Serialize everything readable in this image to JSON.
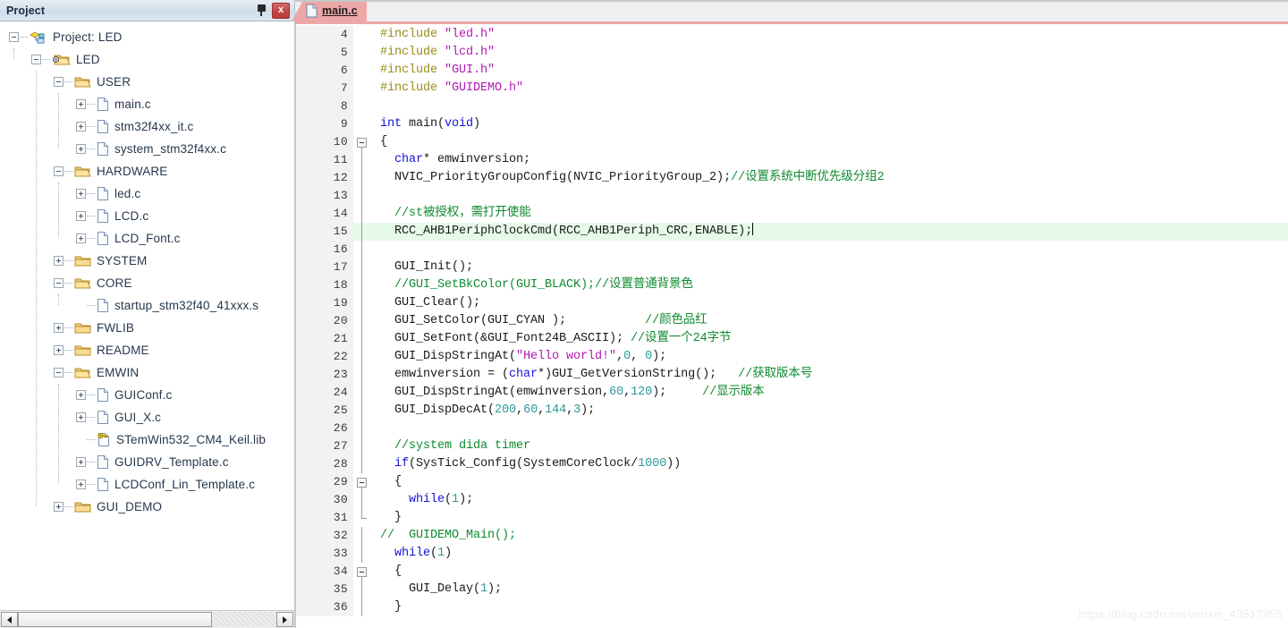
{
  "panel": {
    "title": "Project",
    "pin_icon": "pin-icon",
    "close_icon": "close-icon",
    "close_label": "x"
  },
  "tree": [
    {
      "label": "Project: LED",
      "depth": 0,
      "expander": "minus",
      "icon": "project-icon"
    },
    {
      "label": "LED",
      "depth": 1,
      "expander": "minus",
      "icon": "target-folder-icon"
    },
    {
      "label": "USER",
      "depth": 2,
      "expander": "minus",
      "icon": "folder-open-icon"
    },
    {
      "label": "main.c",
      "depth": 3,
      "expander": "plus",
      "icon": "file-icon"
    },
    {
      "label": "stm32f4xx_it.c",
      "depth": 3,
      "expander": "plus",
      "icon": "file-icon"
    },
    {
      "label": "system_stm32f4xx.c",
      "depth": 3,
      "expander": "plus",
      "icon": "file-icon"
    },
    {
      "label": "HARDWARE",
      "depth": 2,
      "expander": "minus",
      "icon": "folder-open-icon"
    },
    {
      "label": "led.c",
      "depth": 3,
      "expander": "plus",
      "icon": "file-icon"
    },
    {
      "label": "LCD.c",
      "depth": 3,
      "expander": "plus",
      "icon": "file-icon"
    },
    {
      "label": "LCD_Font.c",
      "depth": 3,
      "expander": "plus",
      "icon": "file-icon"
    },
    {
      "label": "SYSTEM",
      "depth": 2,
      "expander": "plus",
      "icon": "folder-closed-icon"
    },
    {
      "label": "CORE",
      "depth": 2,
      "expander": "minus",
      "icon": "folder-open-icon"
    },
    {
      "label": "startup_stm32f40_41xxx.s",
      "depth": 3,
      "expander": "none",
      "icon": "file-icon"
    },
    {
      "label": "FWLIB",
      "depth": 2,
      "expander": "plus",
      "icon": "folder-closed-icon"
    },
    {
      "label": "README",
      "depth": 2,
      "expander": "plus",
      "icon": "folder-closed-icon"
    },
    {
      "label": "EMWIN",
      "depth": 2,
      "expander": "minus",
      "icon": "folder-open-icon"
    },
    {
      "label": "GUIConf.c",
      "depth": 3,
      "expander": "plus",
      "icon": "file-icon"
    },
    {
      "label": "GUI_X.c",
      "depth": 3,
      "expander": "plus",
      "icon": "file-icon"
    },
    {
      "label": "STemWin532_CM4_Keil.lib",
      "depth": 3,
      "expander": "none",
      "icon": "lib-key-icon"
    },
    {
      "label": "GUIDRV_Template.c",
      "depth": 3,
      "expander": "plus",
      "icon": "file-icon"
    },
    {
      "label": "LCDConf_Lin_Template.c",
      "depth": 3,
      "expander": "plus",
      "icon": "file-icon"
    },
    {
      "label": "GUI_DEMO",
      "depth": 2,
      "expander": "plus",
      "icon": "folder-closed-icon"
    }
  ],
  "scrollbar": {
    "left_arrow_icon": "arrow-left-icon",
    "right_arrow_icon": "arrow-right-icon",
    "thumb_percent": 75
  },
  "editor": {
    "tab": {
      "label": "main.c",
      "icon": "document-icon"
    },
    "highlight_line": 15,
    "highlight_color": "#e7f9e9",
    "first_line": 4,
    "colors": {
      "keyword": "#1515d6",
      "preprocessor": "#9a8d1a",
      "string": "#b418b4",
      "comment": "#0f8a2f",
      "number": "#2f9a9a",
      "plain": "#1a1a1a"
    },
    "lines": [
      {
        "n": 4,
        "fold": "none",
        "tokens": [
          {
            "t": "#include ",
            "c": "pp"
          },
          {
            "t": "\"led.h\"",
            "c": "st"
          }
        ]
      },
      {
        "n": 5,
        "fold": "none",
        "tokens": [
          {
            "t": "#include ",
            "c": "pp"
          },
          {
            "t": "\"lcd.h\"",
            "c": "st"
          }
        ]
      },
      {
        "n": 6,
        "fold": "none",
        "tokens": [
          {
            "t": "#include ",
            "c": "pp"
          },
          {
            "t": "\"GUI.h\"",
            "c": "st"
          }
        ]
      },
      {
        "n": 7,
        "fold": "none",
        "tokens": [
          {
            "t": "#include ",
            "c": "pp"
          },
          {
            "t": "\"GUIDEMO.h\"",
            "c": "st"
          }
        ]
      },
      {
        "n": 8,
        "fold": "none",
        "tokens": []
      },
      {
        "n": 9,
        "fold": "none",
        "tokens": [
          {
            "t": "int ",
            "c": "k"
          },
          {
            "t": "main(",
            "c": "pl"
          },
          {
            "t": "void",
            "c": "k"
          },
          {
            "t": ")",
            "c": "pl"
          }
        ]
      },
      {
        "n": 10,
        "fold": "box",
        "tokens": [
          {
            "t": "{",
            "c": "pl"
          }
        ]
      },
      {
        "n": 11,
        "fold": "line",
        "tokens": [
          {
            "t": "  ",
            "c": "pl"
          },
          {
            "t": "char",
            "c": "k"
          },
          {
            "t": "* emwinversion;",
            "c": "pl"
          }
        ]
      },
      {
        "n": 12,
        "fold": "line",
        "tokens": [
          {
            "t": "  NVIC_PriorityGroupConfig(NVIC_PriorityGroup_2);",
            "c": "pl"
          },
          {
            "t": "//设置系统中断优先级分组2",
            "c": "cm"
          }
        ]
      },
      {
        "n": 13,
        "fold": "line",
        "tokens": []
      },
      {
        "n": 14,
        "fold": "line",
        "tokens": [
          {
            "t": "  //st被授权，需打开使能",
            "c": "cm"
          }
        ]
      },
      {
        "n": 15,
        "fold": "line",
        "tokens": [
          {
            "t": "  RCC_AHB1PeriphClockCmd(RCC_AHB1Periph_CRC,ENABLE);",
            "c": "pl"
          }
        ],
        "caret": true
      },
      {
        "n": 16,
        "fold": "line",
        "tokens": []
      },
      {
        "n": 17,
        "fold": "line",
        "tokens": [
          {
            "t": "  GUI_Init();",
            "c": "pl"
          }
        ]
      },
      {
        "n": 18,
        "fold": "line",
        "tokens": [
          {
            "t": "  //GUI_SetBkColor(GUI_BLACK);//设置普通背景色",
            "c": "cm"
          }
        ]
      },
      {
        "n": 19,
        "fold": "line",
        "tokens": [
          {
            "t": "  GUI_Clear();",
            "c": "pl"
          }
        ]
      },
      {
        "n": 20,
        "fold": "line",
        "tokens": [
          {
            "t": "  GUI_SetColor(GUI_CYAN );           ",
            "c": "pl"
          },
          {
            "t": "//颜色品红",
            "c": "cm"
          }
        ]
      },
      {
        "n": 21,
        "fold": "line",
        "tokens": [
          {
            "t": "  GUI_SetFont(&GUI_Font24B_ASCII); ",
            "c": "pl"
          },
          {
            "t": "//设置一个24字节",
            "c": "cm"
          }
        ]
      },
      {
        "n": 22,
        "fold": "line",
        "tokens": [
          {
            "t": "  GUI_DispStringAt(",
            "c": "pl"
          },
          {
            "t": "\"Hello world!\"",
            "c": "st"
          },
          {
            "t": ",",
            "c": "pl"
          },
          {
            "t": "0",
            "c": "nm"
          },
          {
            "t": ", ",
            "c": "pl"
          },
          {
            "t": "0",
            "c": "nm"
          },
          {
            "t": ");",
            "c": "pl"
          }
        ]
      },
      {
        "n": 23,
        "fold": "line",
        "tokens": [
          {
            "t": "  emwinversion = (",
            "c": "pl"
          },
          {
            "t": "char",
            "c": "k"
          },
          {
            "t": "*)GUI_GetVersionString();   ",
            "c": "pl"
          },
          {
            "t": "//获取版本号",
            "c": "cm"
          }
        ]
      },
      {
        "n": 24,
        "fold": "line",
        "tokens": [
          {
            "t": "  GUI_DispStringAt(emwinversion,",
            "c": "pl"
          },
          {
            "t": "60",
            "c": "nm"
          },
          {
            "t": ",",
            "c": "pl"
          },
          {
            "t": "120",
            "c": "nm"
          },
          {
            "t": ");     ",
            "c": "pl"
          },
          {
            "t": "//显示版本",
            "c": "cm"
          }
        ]
      },
      {
        "n": 25,
        "fold": "line",
        "tokens": [
          {
            "t": "  GUI_DispDecAt(",
            "c": "pl"
          },
          {
            "t": "200",
            "c": "nm"
          },
          {
            "t": ",",
            "c": "pl"
          },
          {
            "t": "60",
            "c": "nm"
          },
          {
            "t": ",",
            "c": "pl"
          },
          {
            "t": "144",
            "c": "nm"
          },
          {
            "t": ",",
            "c": "pl"
          },
          {
            "t": "3",
            "c": "nm"
          },
          {
            "t": ");",
            "c": "pl"
          }
        ]
      },
      {
        "n": 26,
        "fold": "line",
        "tokens": []
      },
      {
        "n": 27,
        "fold": "line",
        "tokens": [
          {
            "t": "  //system dida timer",
            "c": "cm"
          }
        ]
      },
      {
        "n": 28,
        "fold": "line",
        "tokens": [
          {
            "t": "  ",
            "c": "pl"
          },
          {
            "t": "if",
            "c": "k"
          },
          {
            "t": "(SysTick_Config(SystemCoreClock/",
            "c": "pl"
          },
          {
            "t": "1000",
            "c": "nm"
          },
          {
            "t": "))",
            "c": "pl"
          }
        ]
      },
      {
        "n": 29,
        "fold": "box",
        "tokens": [
          {
            "t": "  {",
            "c": "pl"
          }
        ]
      },
      {
        "n": 30,
        "fold": "line",
        "tokens": [
          {
            "t": "    ",
            "c": "pl"
          },
          {
            "t": "while",
            "c": "k"
          },
          {
            "t": "(",
            "c": "pl"
          },
          {
            "t": "1",
            "c": "nm"
          },
          {
            "t": ");",
            "c": "pl"
          }
        ]
      },
      {
        "n": 31,
        "fold": "end",
        "tokens": [
          {
            "t": "  }",
            "c": "pl"
          }
        ]
      },
      {
        "n": 32,
        "fold": "line",
        "tokens": [
          {
            "t": "//  GUIDEMO_Main();",
            "c": "cm"
          }
        ]
      },
      {
        "n": 33,
        "fold": "line",
        "tokens": [
          {
            "t": "  ",
            "c": "pl"
          },
          {
            "t": "while",
            "c": "k"
          },
          {
            "t": "(",
            "c": "pl"
          },
          {
            "t": "1",
            "c": "nm"
          },
          {
            "t": ")",
            "c": "pl"
          }
        ]
      },
      {
        "n": 34,
        "fold": "box",
        "tokens": [
          {
            "t": "  {",
            "c": "pl"
          }
        ]
      },
      {
        "n": 35,
        "fold": "line",
        "tokens": [
          {
            "t": "    GUI_Delay(",
            "c": "pl"
          },
          {
            "t": "1",
            "c": "nm"
          },
          {
            "t": ");",
            "c": "pl"
          }
        ]
      },
      {
        "n": 36,
        "fold": "line",
        "tokens": [
          {
            "t": "  }",
            "c": "pl"
          }
        ]
      }
    ]
  },
  "watermark": {
    "text": "https://blog.csdn.net/weixin_43517955"
  }
}
